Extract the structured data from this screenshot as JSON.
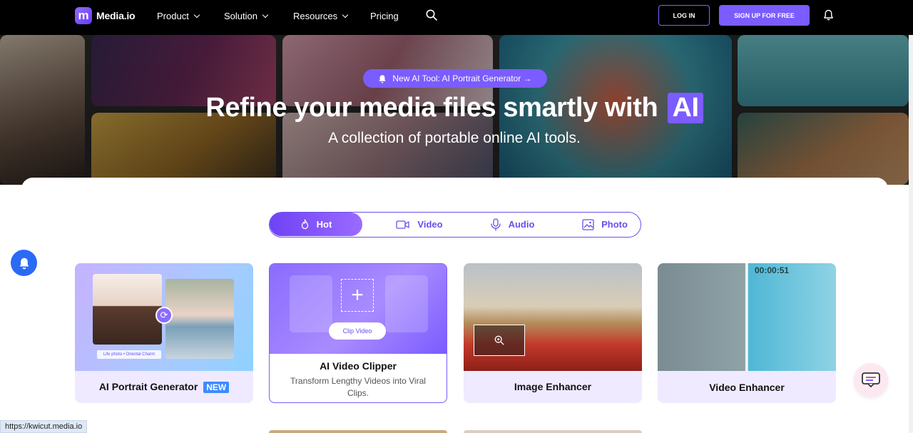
{
  "nav": {
    "logo_text": "Media.io",
    "logo_mark": "m",
    "items": [
      {
        "label": "Product",
        "dropdown": true
      },
      {
        "label": "Solution",
        "dropdown": true
      },
      {
        "label": "Resources",
        "dropdown": true
      },
      {
        "label": "Pricing",
        "dropdown": false
      }
    ],
    "login_label": "LOG IN",
    "signup_label": "SIGN UP FOR FREE",
    "icons": [
      "search-icon",
      "bell-icon"
    ]
  },
  "hero": {
    "badge_text": "New AI Tool: AI Portrait Generator →",
    "title": "Refine your media files smartly with",
    "title_highlight": "AI",
    "subtitle": "A collection of portable online AI tools."
  },
  "tabs": [
    {
      "label": "Hot",
      "icon": "flame-icon",
      "active": true
    },
    {
      "label": "Video",
      "icon": "video-camera-icon",
      "active": false
    },
    {
      "label": "Audio",
      "icon": "microphone-icon",
      "active": false
    },
    {
      "label": "Photo",
      "icon": "image-icon",
      "active": false
    }
  ],
  "cards": [
    {
      "label": "AI Portrait Generator",
      "badge": "NEW",
      "photo_caption": "Life photo  •  Oriental Charm"
    },
    {
      "label": "AI Video Clipper",
      "description": "Transform Lengthy Videos into Viral Clips.",
      "action": "Clip Video"
    },
    {
      "label": "Image Enhancer"
    },
    {
      "label": "Video Enhancer",
      "timestamp": "00:00:51"
    }
  ],
  "status_url": "https://kwicut.media.io",
  "colors": {
    "brand": "#7a5cff",
    "nav_bg": "#000000",
    "card_bg": "#efeaff",
    "accent_blue": "#2a6af5"
  }
}
